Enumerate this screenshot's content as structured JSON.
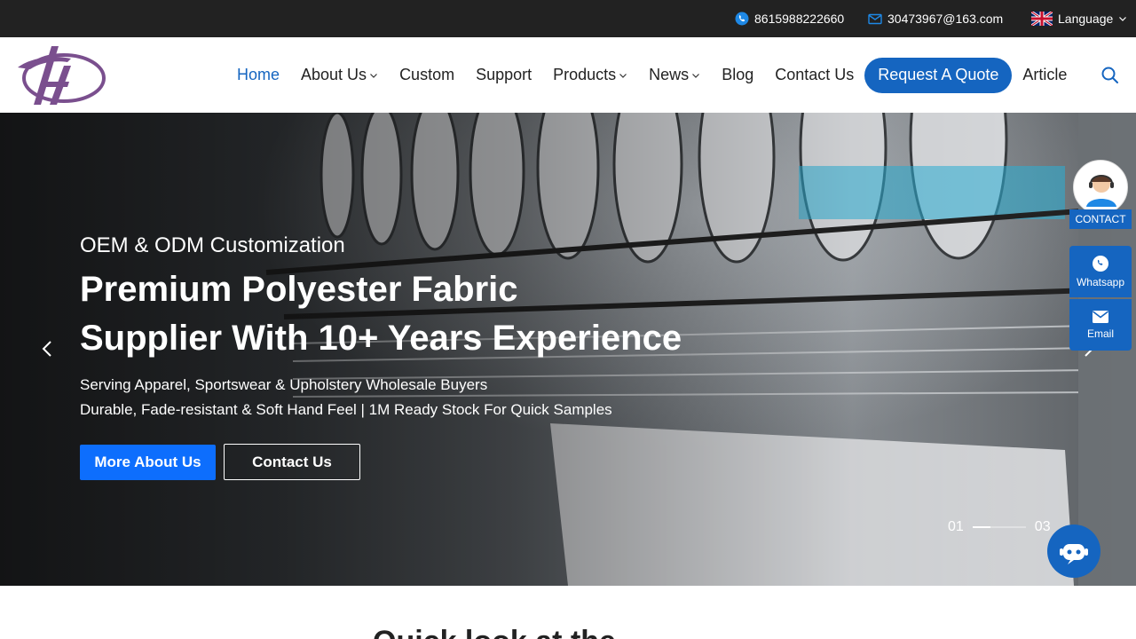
{
  "topbar": {
    "phone": "8615988222660",
    "email": "30473967@163.com",
    "language": "Language",
    "phone_icon": "phone-icon",
    "email_icon": "mail-icon",
    "flag_icon": "uk-flag-icon"
  },
  "nav": {
    "items": [
      {
        "label": "Home",
        "active": true
      },
      {
        "label": "About Us",
        "dropdown": true
      },
      {
        "label": "Custom"
      },
      {
        "label": "Support"
      },
      {
        "label": "Products",
        "dropdown": true
      },
      {
        "label": "News",
        "dropdown": true
      },
      {
        "label": "Blog"
      },
      {
        "label": "Contact Us"
      }
    ],
    "quote_label": "Request A Quote",
    "article_label": "Article",
    "search_icon": "search-icon"
  },
  "hero": {
    "subtitle": "OEM & ODM Customization",
    "title_line1": "Premium Polyester Fabric",
    "title_line2": "Supplier With 10+ Years Experience",
    "desc_line1": "Serving Apparel, Sportswear & Upholstery Wholesale Buyers",
    "desc_line2": "Durable, Fade-resistant & Soft Hand Feel | 1M Ready Stock For Quick Samples",
    "btn_more": "More About Us",
    "btn_contact": "Contact Us",
    "pager_current": "01",
    "pager_total": "03"
  },
  "floating": {
    "contact_label": "CONTACT",
    "whatsapp_label": "Whatsapp",
    "email_label": "Email"
  },
  "section": {
    "title_partial": "Quick look at the"
  },
  "colors": {
    "topbar_bg": "#222222",
    "accent": "#1565c0",
    "hero_button": "#0d6efd",
    "logo_purple": "#7a4f8e"
  }
}
